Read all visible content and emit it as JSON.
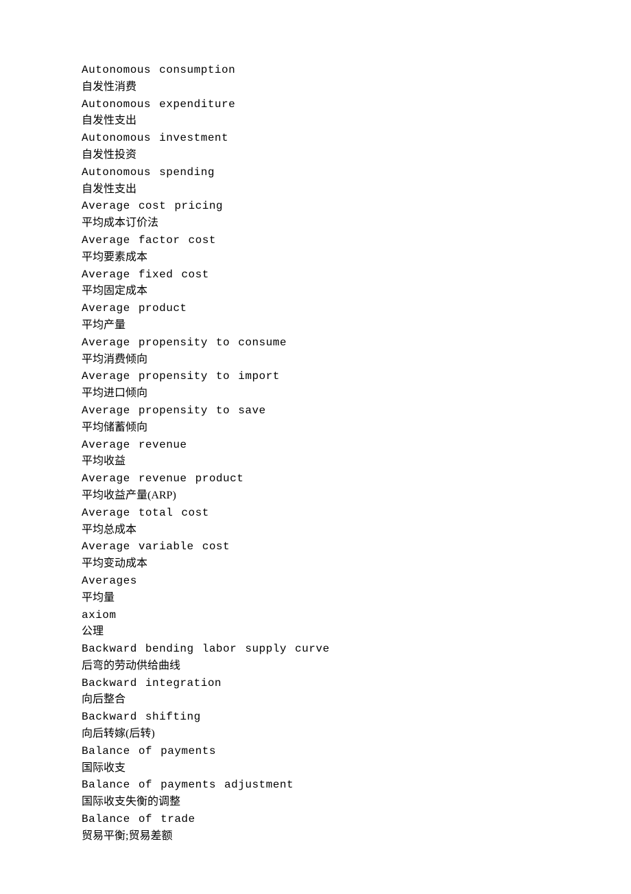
{
  "entries": [
    {
      "term": "Autonomous consumption",
      "def": "自发性消费"
    },
    {
      "term": "Autonomous expenditure",
      "def": "自发性支出"
    },
    {
      "term": "Autonomous investment",
      "def": "自发性投资"
    },
    {
      "term": "Autonomous spending",
      "def": "自发性支出"
    },
    {
      "term": "Average cost pricing",
      "def": "平均成本订价法"
    },
    {
      "term": "Average factor cost",
      "def": "平均要素成本"
    },
    {
      "term": "Average fixed cost",
      "def": "平均固定成本"
    },
    {
      "term": "Average product",
      "def": "平均产量"
    },
    {
      "term": "Average propensity to consume",
      "def": "平均消费倾向"
    },
    {
      "term": "Average propensity to import",
      "def": "平均进口倾向"
    },
    {
      "term": "Average propensity to save",
      "def": "平均储蓄倾向"
    },
    {
      "term": "Average revenue",
      "def": "平均收益"
    },
    {
      "term": "Average revenue product",
      "def": "平均收益产量(ARP)"
    },
    {
      "term": "Average total cost",
      "def": "平均总成本"
    },
    {
      "term": "Average variable cost",
      "def": "平均变动成本"
    },
    {
      "term": "Averages",
      "def": "平均量"
    },
    {
      "term": "axiom",
      "def": "公理"
    },
    {
      "term": "Backward bending labor supply curve",
      "def": "后弯的劳动供给曲线"
    },
    {
      "term": "Backward integration",
      "def": "向后整合"
    },
    {
      "term": "Backward shifting",
      "def": "向后转嫁(后转)"
    },
    {
      "term": "Balance of payments",
      "def": "国际收支"
    },
    {
      "term": "Balance of payments adjustment",
      "def": "国际收支失衡的调整"
    },
    {
      "term": "Balance of trade",
      "def": "贸易平衡;贸易差额"
    }
  ]
}
